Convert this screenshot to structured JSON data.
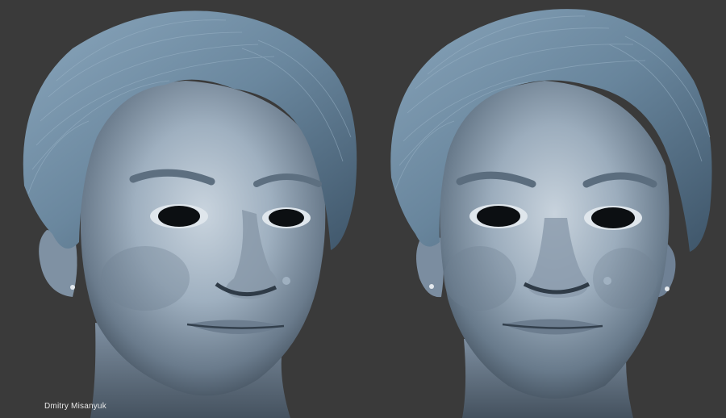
{
  "artwork": {
    "signature": "Dmitry Misanyuk"
  },
  "colors": {
    "background": "#3a3a3a",
    "skin": "#8ea0b3",
    "skin_light": "#c3cfd9",
    "skin_shadow": "#4b5a6a",
    "hair": "#6b88a0",
    "hair_dark": "#3d5366"
  }
}
